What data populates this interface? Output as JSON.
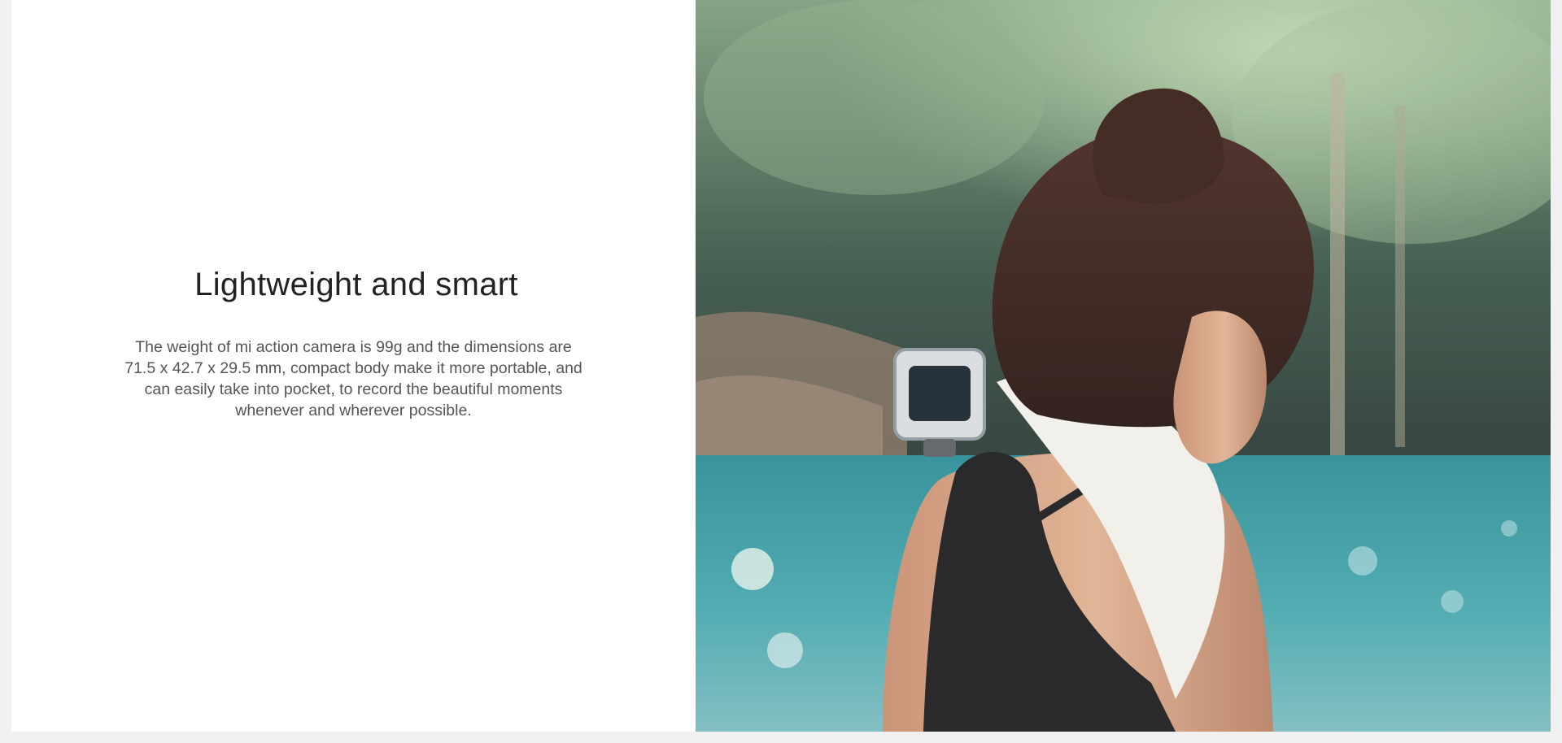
{
  "feature": {
    "title": "Lightweight and smart",
    "description": "The weight of mi action camera is 99g and the dimensions are 71.5 x 42.7 x 29.5 mm, compact body make it more portable, and can easily take into pocket, to record the beautiful moments whenever and wherever possible."
  },
  "photo": {
    "icon": "lifestyle-photo-icon"
  },
  "colors": {
    "page_background": "#f0f0f0",
    "panel_background": "#ffffff",
    "title_text": "#222222",
    "body_text": "#555555",
    "water": "#3f9fa6",
    "foliage": "#5f8a70"
  }
}
